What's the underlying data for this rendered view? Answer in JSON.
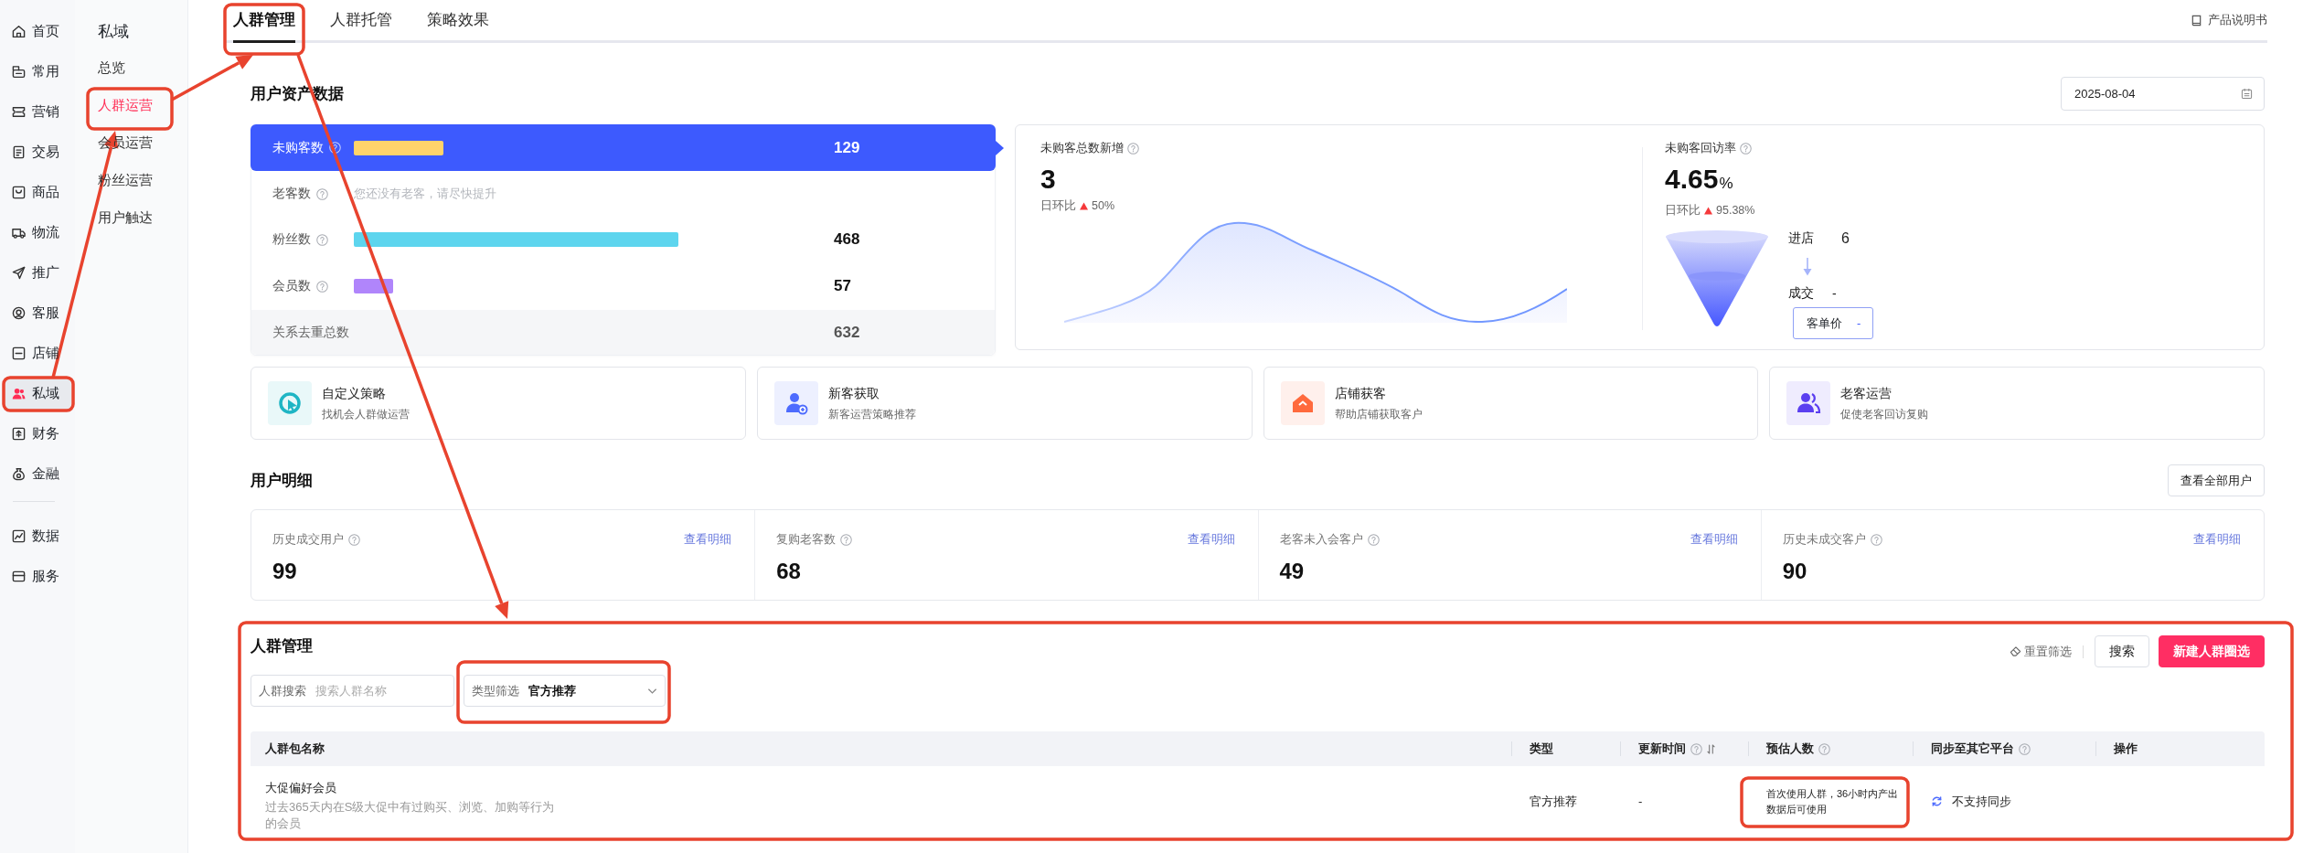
{
  "nav": [
    {
      "items": [
        {
          "label": "首页",
          "selected": false
        },
        {
          "label": "常用",
          "selected": false
        },
        {
          "label": "营销",
          "selected": false
        },
        {
          "label": "交易",
          "selected": false
        },
        {
          "label": "商品",
          "selected": false
        },
        {
          "label": "物流",
          "selected": false
        },
        {
          "label": "推广",
          "selected": false
        },
        {
          "label": "客服",
          "selected": false
        },
        {
          "label": "店铺",
          "selected": false
        },
        {
          "label": "私域",
          "selected": true
        },
        {
          "label": "财务",
          "selected": false
        },
        {
          "label": "金融",
          "selected": false
        }
      ]
    },
    {
      "items": [
        {
          "label": "数据",
          "selected": false
        },
        {
          "label": "服务",
          "selected": false
        }
      ]
    }
  ],
  "submenu": {
    "title": "私域",
    "items": [
      {
        "label": "总览",
        "selected": false
      },
      {
        "label": "人群运营",
        "selected": true
      },
      {
        "label": "会员运营",
        "selected": false
      },
      {
        "label": "粉丝运营",
        "selected": false
      },
      {
        "label": "用户触达",
        "selected": false
      }
    ]
  },
  "tabs": [
    {
      "label": "人群管理",
      "selected": true
    },
    {
      "label": "人群托管",
      "selected": false
    },
    {
      "label": "策略效果",
      "selected": false
    }
  ],
  "manual_link": "产品说明书",
  "asset_data": {
    "title": "用户资产数据",
    "date": "2025-08-04",
    "rows": [
      {
        "kind": "bar",
        "label": "未购客数",
        "selected": true,
        "color": "#ffd36b",
        "value": "129"
      },
      {
        "kind": "note",
        "label": "老客数",
        "selected": false,
        "note": "您还没有老客，请尽快提升"
      },
      {
        "kind": "bar",
        "label": "粉丝数",
        "selected": false,
        "color": "#5dd5ee",
        "value": "468"
      },
      {
        "kind": "bar",
        "label": "会员数",
        "selected": false,
        "color": "#b085fb",
        "value": "57"
      }
    ],
    "total": {
      "label": "关系去重总数",
      "value": "632"
    }
  },
  "new_customers": {
    "title": "未购客总数新增",
    "value": "3",
    "compare_label": "日环比",
    "increase": true,
    "change": "50%"
  },
  "revisit_rate": {
    "title": "未购客回访率",
    "value": "4.65",
    "unit": "%",
    "compare_label": "日环比",
    "increase": true,
    "change": "95.38%",
    "funnel": {
      "enter_label": "进店",
      "enter_value": "6",
      "deal_label": "成交",
      "deal_value": "-",
      "price_label": "客单价",
      "price_value": "-"
    }
  },
  "strategies": [
    {
      "title": "自定义策略",
      "subtitle": "找机会人群做运营",
      "color": "#1fb5c4"
    },
    {
      "title": "新客获取",
      "subtitle": "新客运营策略推荐",
      "color": "#4d6bfe"
    },
    {
      "title": "店铺获客",
      "subtitle": "帮助店铺获取客户",
      "color": "#ff6a3d"
    },
    {
      "title": "老客运营",
      "subtitle": "促使老客回访复购",
      "color": "#5b3ff0"
    }
  ],
  "user_details": {
    "title": "用户明细",
    "view_all": "查看全部用户",
    "cards": [
      {
        "label": "历史成交用户",
        "link": "查看明细",
        "value": "99"
      },
      {
        "label": "复购老客数",
        "link": "查看明细",
        "value": "68"
      },
      {
        "label": "老客未入会客户",
        "link": "查看明细",
        "value": "49"
      },
      {
        "label": "历史未成交客户",
        "link": "查看明细",
        "value": "90"
      }
    ]
  },
  "crowd_management": {
    "title": "人群管理",
    "reset": "重置筛选",
    "search_button": "搜索",
    "create_button": "新建人群圈选",
    "search_field": {
      "label": "人群搜索",
      "placeholder": "搜索人群名称"
    },
    "type_filter": {
      "label": "类型筛选",
      "value": "官方推荐"
    },
    "table": {
      "columns": [
        {
          "label": "人群包名称",
          "help": false,
          "sortable": false
        },
        {
          "label": "类型",
          "help": false,
          "sortable": false
        },
        {
          "label": "更新时间",
          "help": true,
          "sortable": true
        },
        {
          "label": "预估人数",
          "help": true,
          "sortable": false
        },
        {
          "label": "同步至其它平台",
          "help": true,
          "sortable": false
        },
        {
          "label": "操作",
          "help": false,
          "sortable": false
        }
      ],
      "rows": [
        {
          "name": "大促偏好会员",
          "description": "过去365天内在S级大促中有过购买、浏览、加购等行为的会员",
          "type": "官方推荐",
          "updated": "-",
          "estimate": "首次使用人群，36小时内产出数据后可使用",
          "sync": "不支持同步"
        }
      ]
    }
  }
}
